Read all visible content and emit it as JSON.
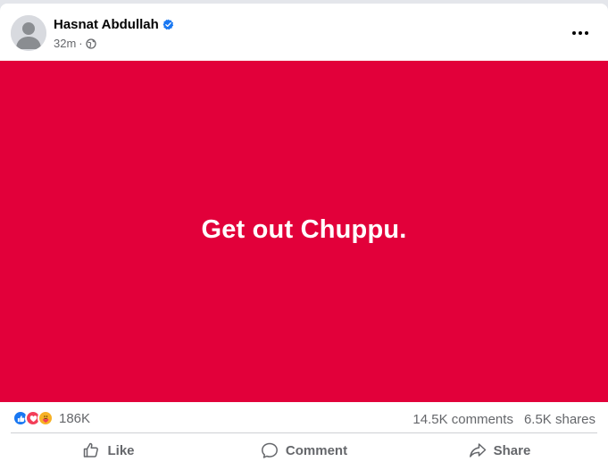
{
  "post": {
    "author_name": "Hasnat Abdullah",
    "timestamp": "32m",
    "separator": "·",
    "audience_icon": "globe-icon",
    "verified_icon": "verified-badge-icon",
    "image_text": "Get out Chuppu.",
    "image_bg_color": "#e2003a"
  },
  "stats": {
    "reaction_icons": [
      "like-reaction-icon",
      "love-reaction-icon",
      "care-reaction-icon"
    ],
    "reaction_count": "186K",
    "comments": "14.5K comments",
    "shares": "6.5K shares"
  },
  "actions": {
    "like_label": "Like",
    "comment_label": "Comment",
    "share_label": "Share"
  },
  "colors": {
    "accent": "#1877f2",
    "love": "#f33e58",
    "care": "#f7b125",
    "secondary_text": "#65676b"
  }
}
